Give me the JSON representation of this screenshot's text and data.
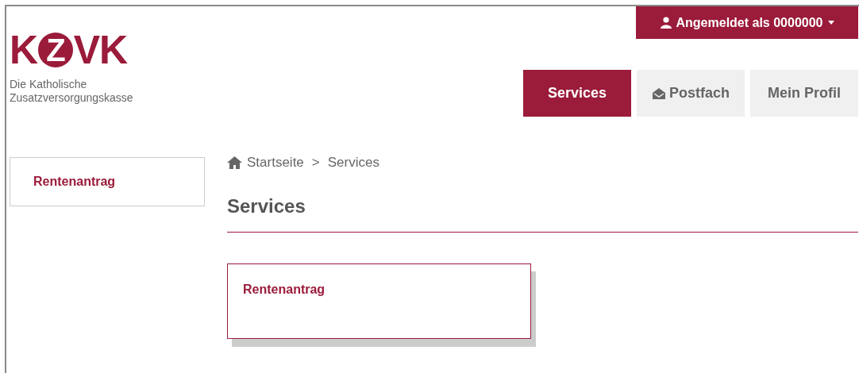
{
  "logo": {
    "text_left": "K",
    "circled": "Z",
    "text_right": "VK",
    "tagline": [
      "Die Katholische",
      "Zusatzversorgungskasse"
    ]
  },
  "user_menu": {
    "label": "Angemeldet als 0000000"
  },
  "nav": [
    {
      "label": "Services",
      "kind": "text",
      "selected": true
    },
    {
      "label": "Postfach",
      "kind": "mail",
      "selected": false
    },
    {
      "label": "Mein Profil",
      "kind": "text",
      "selected": false
    }
  ],
  "sidebar": {
    "items": [
      {
        "label": "Rentenantrag"
      }
    ]
  },
  "breadcrumb": [
    "Startseite",
    ">",
    "Services"
  ],
  "heading": "Services",
  "cards": [
    {
      "title": "Rentenantrag"
    }
  ]
}
